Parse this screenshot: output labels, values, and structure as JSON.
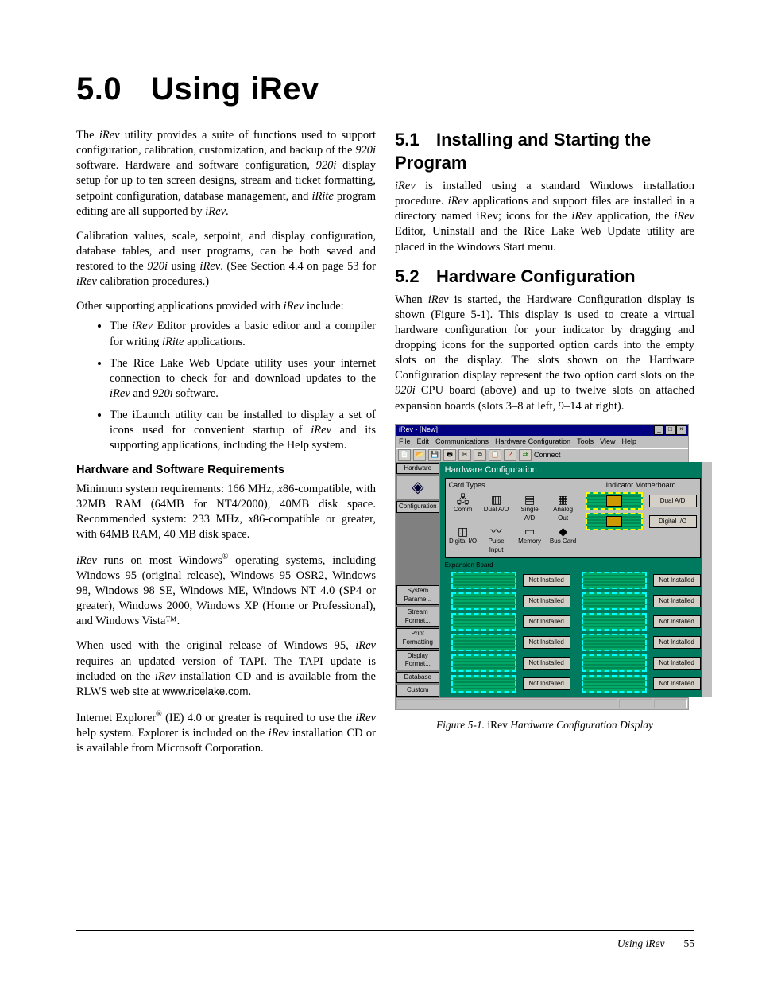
{
  "chapter": {
    "number": "5.0",
    "title": "Using iRev"
  },
  "left": {
    "p1_a": "The ",
    "p1_b": " utility provides a suite of functions used to support configuration, calibration, customization, and backup of the ",
    "p1_c": " software. Hardware and software configuration, ",
    "p1_d": " display setup for up to ten screen designs, stream and ticket formatting, setpoint configuration, database management, and ",
    "p1_e": " program editing are all supported by ",
    "p1_end": ".",
    "p2_a": "Calibration values, scale, setpoint, and display configuration, database tables, and user programs, can be both saved and restored to the ",
    "p2_b": " using ",
    "p2_c": ". (See Section 4.4 on page 53 for ",
    "p2_d": " calibration procedures.)",
    "p3_a": "Other supporting applications provided with ",
    "p3_b": " include:",
    "bul1_a": "The ",
    "bul1_b": " Editor provides a basic editor and a compiler for writing ",
    "bul1_c": " applications.",
    "bul2_a": "The Rice Lake Web Update utility uses your internet connection to check for and download updates to the ",
    "bul2_b": " and ",
    "bul2_c": " software.",
    "bul3_a": "The iLaunch utility can be installed to display a set of icons used for convenient startup of ",
    "bul3_b": " and its supporting applications, including the Help system.",
    "hw_head": "Hardware and Software Requirements",
    "hw_p1_a": "Minimum system requirements: 166 MHz, ",
    "hw_p1_b": "86-compatible, with 32MB RAM (64MB for NT4/2000), 40MB disk space. Recommended system: 233 MHz, ",
    "hw_p1_c": "86-compatible or greater, with 64MB RAM, 40 MB disk space.",
    "hw_p2_a": " runs on most Windows",
    "hw_p2_b": " operating systems, including Windows 95 (original release), Windows 95 OSR2, Windows 98, Windows 98 SE, Windows ME, Windows NT 4.0 (SP4 or greater), Windows 2000, Windows XP (Home or Professional), and Windows Vista™.",
    "hw_p3_a": "When used with the original release of Windows 95, ",
    "hw_p3_b": " requires an updated version of TAPI. The TAPI update is included on the ",
    "hw_p3_c": " installation CD and is available from the RLWS web site at ",
    "hw_p3_url": "www.ricelake.com",
    "hw_p3_end": ".",
    "hw_p4_a": "Internet Explorer",
    "hw_p4_b": " (IE) 4.0 or greater is required to use the ",
    "hw_p4_c": " help system. Explorer is included on the ",
    "hw_p4_d": " installation CD or is available from Microsoft Corporation."
  },
  "right": {
    "s51": {
      "num": "5.1",
      "title": "Installing and Starting the Program"
    },
    "s51_p_a": " is installed using a standard Windows installation procedure. ",
    "s51_p_b": " applications and support files are installed in a directory named iRev; icons for the ",
    "s51_p_c": " application, the ",
    "s51_p_d": " Editor, Uninstall and the Rice Lake Web Update utility are placed in the Windows Start menu.",
    "s52": {
      "num": "5.2",
      "title": "Hardware Configuration"
    },
    "s52_p_a": "When ",
    "s52_p_b": " is started, the Hardware Configuration display is shown (Figure 5-1). This display is used to create a virtual hardware configuration for your indicator by dragging and dropping icons for the supported option cards into the empty slots on the display. The slots shown on the Hardware Configuration display represent the two option card slots on the ",
    "s52_p_c": " CPU board (above) and up to twelve slots on attached expansion boards (slots 3–8 at left, 9–14 at right).",
    "fig_caption_a": "Figure 5-1. ",
    "fig_caption_b": " Hardware Configuration Display"
  },
  "terms": {
    "iRev": "iRev",
    "iRite": "iRite",
    "920i": "920i",
    "x": "x"
  },
  "screenshot": {
    "title": "iRev - [New]",
    "menus": [
      "File",
      "Edit",
      "Communications",
      "Hardware Configuration",
      "Tools",
      "View",
      "Help"
    ],
    "toolbar_connect": "Connect",
    "side": {
      "tab_hardware": "Hardware",
      "tab_configuration": "Configuration",
      "tabs_bottom": [
        "System Parame...",
        "Stream Format...",
        "Print Formatting",
        "Display Format...",
        "Database",
        "Custom"
      ]
    },
    "main_title": "Hardware Configuration",
    "cardtypes_title": "Card Types",
    "motherboard_title": "Indicator Motherboard",
    "cards_row1": [
      "Comm",
      "Dual A/D",
      "Single A/D",
      "Analog Out"
    ],
    "cards_row2": [
      "Digital I/O",
      "Pulse Input",
      "Memory",
      "Bus Card"
    ],
    "mb_buttons": [
      "Dual A/D",
      "Digital I/O"
    ],
    "exp_title": "Expansion Board",
    "not_installed": "Not Installed"
  },
  "footer": {
    "title": "Using iRev",
    "page": "55"
  }
}
